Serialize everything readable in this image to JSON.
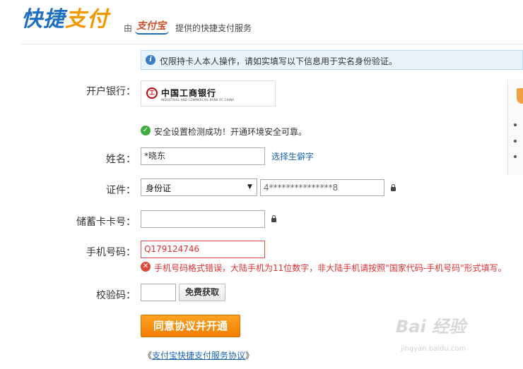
{
  "header": {
    "logo_part1": "快捷",
    "logo_part2": "支付",
    "by": "由",
    "alipay_logo": "支付宝",
    "service_text": "提供的快捷支付服务"
  },
  "notice": {
    "icon": "info-icon",
    "text": "仅限持卡人本人操作，请如实填写以下信息用于实名身份验证。"
  },
  "form": {
    "bank": {
      "label": "开户银行：",
      "icon_glyph": "工",
      "name": "中国工商银行",
      "name_en": "INDUSTRIAL AND COMMERCIAL BANK OF CHINA"
    },
    "security": {
      "icon": "check-icon",
      "text": "安全设置检测成功！开通环境安全可靠。"
    },
    "name": {
      "label": "姓名：",
      "value": "*晓东",
      "link": "选择生僻字"
    },
    "id": {
      "label": "证件：",
      "type": "身份证",
      "caret": "▼",
      "number": "4***************8"
    },
    "card": {
      "label": "储蓄卡卡号：",
      "value": ""
    },
    "phone": {
      "label": "手机号码：",
      "value": "Q179124746",
      "error": "手机号码格式错误，大陆手机为11位数字，非大陆手机请按照\"国家代码-手机号码\"形式填写。",
      "error_glyph": "✕"
    },
    "code": {
      "label": "校验码：",
      "value": "",
      "button": "免费获取"
    },
    "submit": "同意协议并开通",
    "agreement": {
      "open": "《",
      "link": "支付宝快捷支付服务协议",
      "close": "》"
    }
  },
  "watermark": {
    "text": "Bai 经验",
    "sub": "jingyan.baidu.com"
  },
  "colors": {
    "brand_blue": "#1e6fc3",
    "brand_orange": "#f39800",
    "error_red": "#e03030",
    "success_green": "#3fae3f"
  }
}
